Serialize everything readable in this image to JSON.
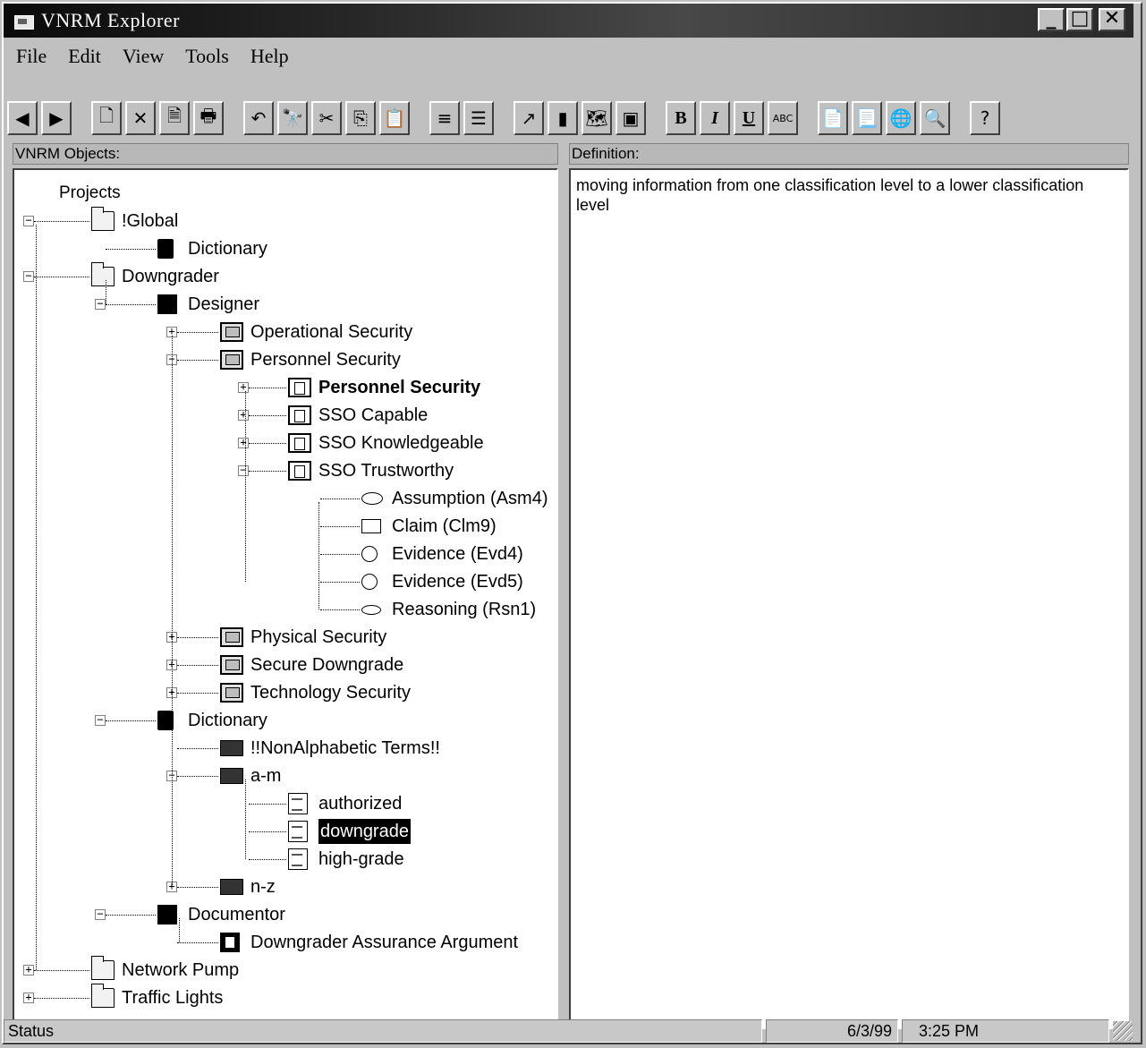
{
  "window": {
    "title": "VNRM Explorer"
  },
  "menu": [
    "File",
    "Edit",
    "View",
    "Tools",
    "Help"
  ],
  "toolbar": {
    "buttons": [
      "back",
      "forward",
      "new",
      "delete",
      "properties",
      "print",
      "undo",
      "find",
      "cut",
      "copy",
      "paste",
      "align-left",
      "align-justify",
      "export",
      "dictionary",
      "graph",
      "document",
      "bold",
      "italic",
      "underline",
      "spellcheck",
      "report",
      "report2",
      "globe",
      "search",
      "help"
    ],
    "glyphs": [
      "◀",
      "▶",
      "🗋",
      "✕",
      "🗎",
      "🖶",
      "↶",
      "🔭",
      "✂",
      "⎘",
      "📋",
      "≡",
      "☰",
      "↗",
      "▮",
      "🗺",
      "▣",
      "B",
      "I",
      "U",
      "ABC",
      "📄",
      "📃",
      "🌐",
      "🔍",
      "?"
    ]
  },
  "left_pane": {
    "header": "VNRM Objects:"
  },
  "right_pane": {
    "header": "Definition:",
    "text": "moving information from one classification level to a lower classification level"
  },
  "tree": {
    "root": "Projects",
    "nodes": [
      "!Global",
      "Dictionary",
      "Downgrader",
      "Designer",
      "Operational Security",
      "Personnel Security",
      "Personnel Security",
      "SSO Capable",
      "SSO Knowledgeable",
      "SSO Trustworthy",
      "Assumption (Asm4)",
      "Claim (Clm9)",
      "Evidence (Evd4)",
      "Evidence (Evd5)",
      "Reasoning (Rsn1)",
      "Physical Security",
      "Secure Downgrade",
      "Technology Security",
      "Dictionary",
      "!!NonAlphabetic Terms!!",
      "a-m",
      "authorized",
      "downgrade",
      "high-grade",
      "n-z",
      "Documentor",
      "Downgrader Assurance Argument",
      "Network Pump",
      "Traffic Lights"
    ]
  },
  "status": {
    "label": "Status",
    "date": "6/3/99",
    "time": "3:25 PM"
  }
}
